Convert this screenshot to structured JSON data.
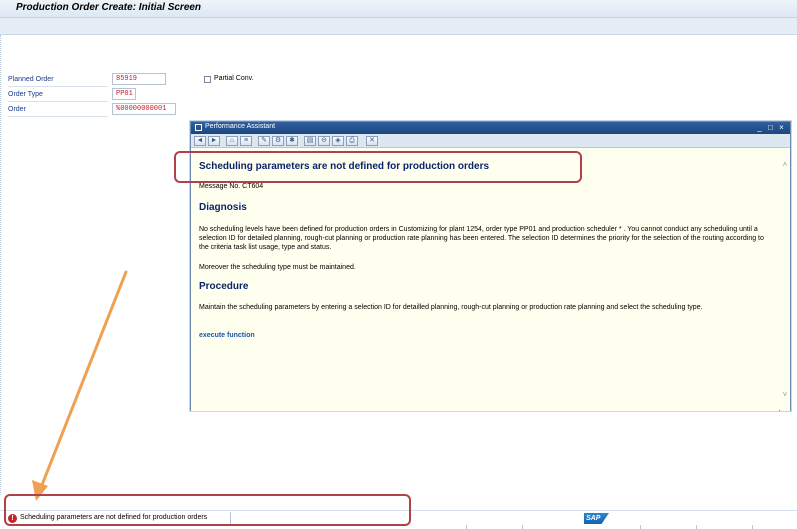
{
  "window": {
    "title": "Production Order Create: Initial Screen"
  },
  "form": {
    "planned_order_label": "Planned Order",
    "planned_order_value": "85919",
    "order_type_label": "Order Type",
    "order_type_value": "PP01",
    "order_label": "Order",
    "order_value": "%00000000001",
    "partial_conv_label": "Partial Conv."
  },
  "assistant": {
    "title": "Performance Assistant",
    "heading": "Scheduling parameters are not defined for production orders",
    "message_no": "Message No. CT604",
    "diagnosis_title": "Diagnosis",
    "diagnosis_text": "No scheduling levels have been defined for production orders  in Customizing for plant 1254, order type PP01 and production scheduler * . You cannot conduct any scheduling until a selection ID for detailed planning, rough-cut planning or production rate planning has been entered. The selection ID determines the priority for the selection of the routing according to the criteria task list usage, type and status.",
    "diagnosis_text2": "Moreover the scheduling type must be maintained.",
    "procedure_title": "Procedure",
    "procedure_text": "Maintain the scheduling parameters by entering a selection ID for detailled planning, rough-cut planning or production rate planning and select the scheduling type.",
    "execute_link": "execute function"
  },
  "status_bar": {
    "message": "Scheduling parameters are not defined for production orders",
    "logo": "SAP"
  },
  "colors": {
    "accent": "#0a246a",
    "highlight": "#b0404a",
    "arrow": "#f0a050",
    "error": "#c0272d"
  }
}
